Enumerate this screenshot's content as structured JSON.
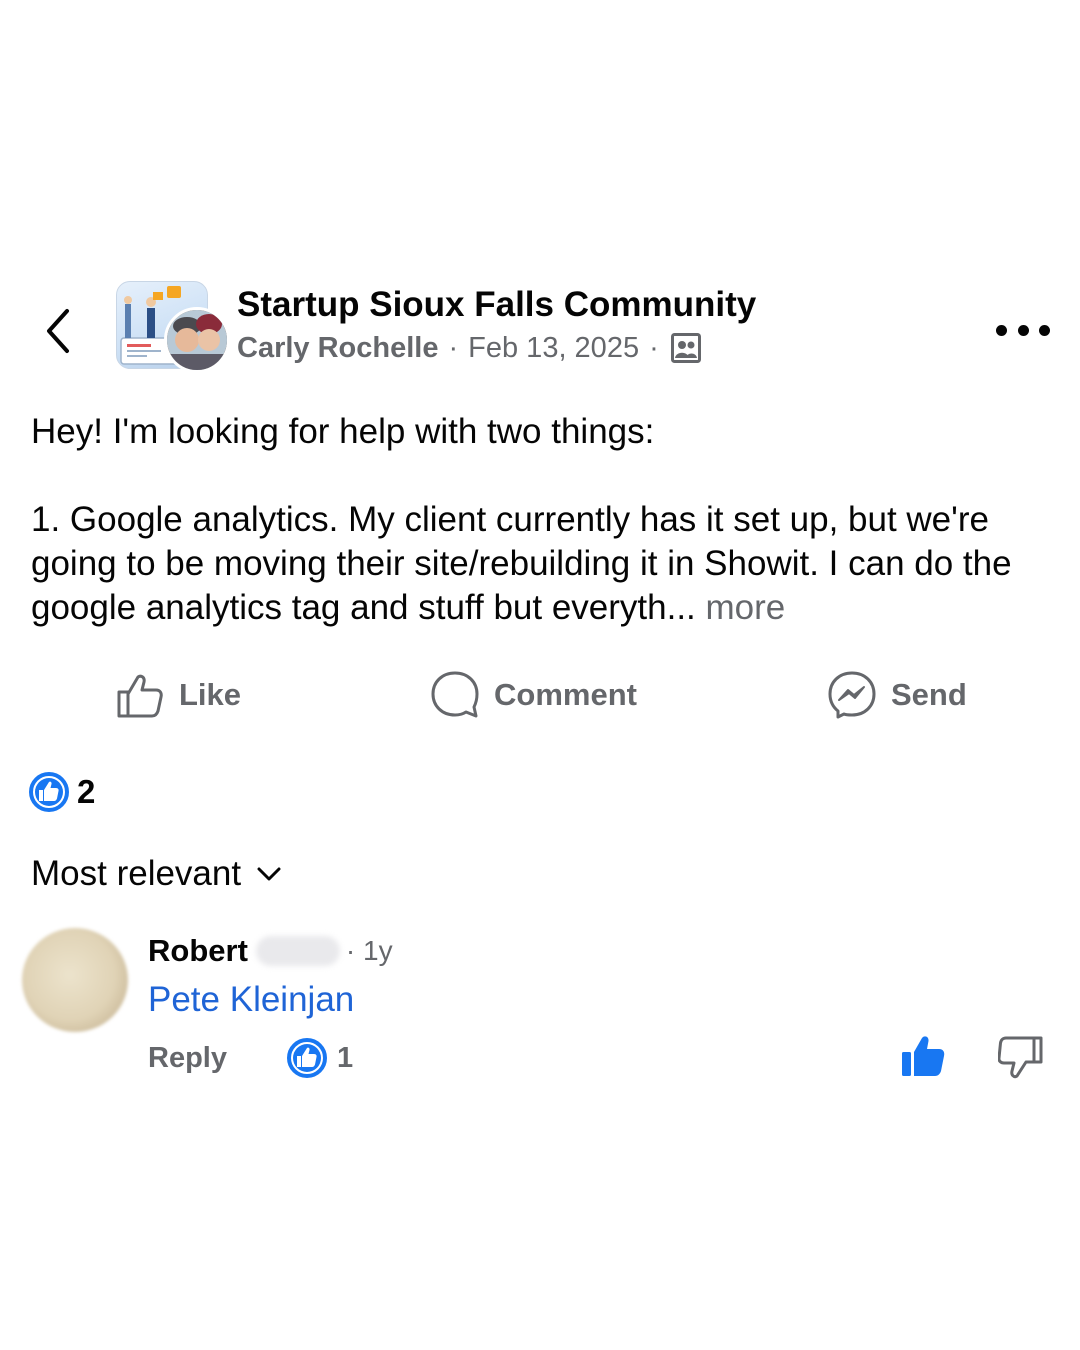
{
  "header": {
    "group_name": "Startup Sioux Falls Community",
    "author": "Carly Rochelle",
    "date": "Feb 13, 2025",
    "separator": "·",
    "audience_icon": "group-members-icon"
  },
  "post": {
    "line_1": "Hey! I'm looking for help with two things:",
    "paragraph_2": "1. Google analytics. My client currently has it set up, but we're going to be moving their site/rebuilding it in Showit. I can do the google analytics tag and stuff but everyth... ",
    "see_more": "more"
  },
  "actions": {
    "like": "Like",
    "comment": "Comment",
    "send": "Send"
  },
  "reactions": {
    "count": "2"
  },
  "sort": {
    "label": "Most relevant"
  },
  "comment": {
    "author": "Robert",
    "time": "· 1y",
    "text": "Pete Kleinjan",
    "reply": "Reply",
    "reaction_count": "1"
  },
  "colors": {
    "text_primary": "#050505",
    "text_secondary": "#65676b",
    "link_blue": "#1f64d6",
    "like_blue": "#1877f2"
  }
}
